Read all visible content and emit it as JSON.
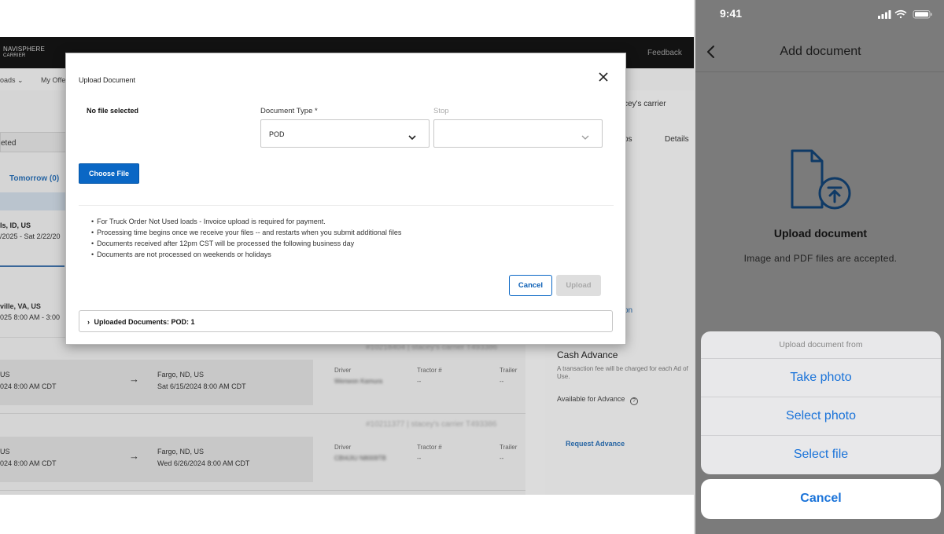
{
  "desktop": {
    "brand_line1": "NAVISPHERE",
    "brand_line2": "CARRIER",
    "feedback": "Feedback",
    "nav_loads": "oads",
    "nav_my_offers": "My Offe",
    "tab_completed": "eted",
    "tab_tomorrow": "Tomorrow (0)",
    "result1_line1": "ls, ID, US",
    "result1_line2": "/2025 - Sat 2/22/20",
    "result2_line1": "ville, VA, US",
    "result2_line2": "025 8:00 AM - 3:00",
    "right_carrier": "cey's carrier",
    "right_tab_stops": "ps",
    "right_tab_details": "Details",
    "right_link_fragment": "on",
    "cash_advance_title": "Cash Advance",
    "cash_advance_note": "A transaction fee will be charged for each Ad of Use.",
    "available_for_advance": "Available for Advance",
    "request_advance": "Request Advance",
    "loads": [
      {
        "ref": "#10218404 | stacey's carrier T493386",
        "origin": "US",
        "origin_time": "024 8:00 AM CDT",
        "dest": "Fargo, ND, US",
        "dest_time": "Sat 6/15/2024 8:00 AM CDT",
        "driver_label": "Driver",
        "driver_value": "Wenwon Kamura",
        "tractor_label": "Tractor #",
        "tractor_value": "--",
        "trailer_label": "Trailer",
        "trailer_value": "--"
      },
      {
        "ref": "#10211377 | stacey's carrier T493386",
        "origin": "US",
        "origin_time": "024 8:00 AM CDT",
        "dest": "Fargo, ND, US",
        "dest_time": "Wed 6/26/2024 8:00 AM CDT",
        "driver_label": "Driver",
        "driver_value": "CBI4JIU N8009TB",
        "tractor_label": "Tractor #",
        "tractor_value": "--",
        "trailer_label": "Trailer",
        "trailer_value": "--"
      }
    ]
  },
  "modal": {
    "title": "Upload Document",
    "no_file": "No file selected",
    "doc_type_label": "Document Type *",
    "doc_type_value": "POD",
    "stop_label": "Stop",
    "stop_value": "",
    "choose_file": "Choose File",
    "notes": [
      "For Truck Order Not Used loads - Invoice upload is required for payment.",
      "Processing time begins once we receive your files -- and restarts when you submit additional files",
      "Documents received after 12pm CST will be processed the following business day",
      "Documents are not processed on weekends or holidays"
    ],
    "cancel": "Cancel",
    "upload": "Upload",
    "uploaded_documents": "Uploaded Documents: POD: 1"
  },
  "phone": {
    "time": "9:41",
    "title": "Add document",
    "upload_heading": "Upload document",
    "upload_sub": "Image and PDF files are accepted.",
    "sheet_title": "Upload document from",
    "options": [
      "Take photo",
      "Select photo",
      "Select file"
    ],
    "cancel": "Cancel",
    "accent_color": "#1a73d9"
  },
  "icons": [
    "close-icon",
    "chevron-down-icon",
    "caret-right-icon",
    "arrow-right-icon",
    "help-circle-icon",
    "back-chevron-icon",
    "document-upload-icon",
    "signal-icon",
    "wifi-icon",
    "battery-icon"
  ]
}
